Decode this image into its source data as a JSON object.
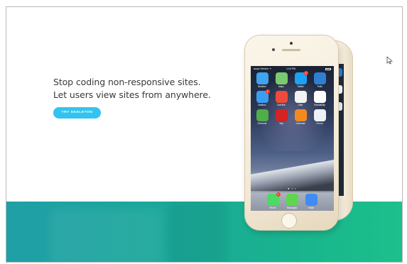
{
  "hero": {
    "headline_line1": "Stop coding non-responsive sites.",
    "headline_line2": "Let users view sites from anywhere.",
    "cta_label": "TRY SKELETON"
  },
  "colors": {
    "cta": "#33c3f0",
    "band_start": "#1f9fa6",
    "band_end": "#1cc08c",
    "phone_gold": "#f5ecda"
  },
  "phone": {
    "status_carrier": "●●●● Verizon ᯤ",
    "status_time": "1:16 PM",
    "page_dots": "● • •",
    "apps": [
      {
        "name": "Weather",
        "icon": "weather-icon",
        "color": "#3fa3ef"
      },
      {
        "name": "Maps",
        "icon": "maps-icon",
        "color": "#7bc96f"
      },
      {
        "name": "Twitter",
        "icon": "twitter-icon",
        "color": "#1da1f2",
        "badge": "1"
      },
      {
        "name": "Trello",
        "icon": "trello-icon",
        "color": "#2f7fd1"
      },
      {
        "name": "Mailbox",
        "icon": "mailbox-icon",
        "color": "#3a9ef0",
        "badge": "1"
      },
      {
        "name": "DotHide",
        "icon": "dot-icon",
        "color": "#ef4b3a"
      },
      {
        "name": "Ulfar",
        "icon": "ulfar-icon",
        "color": "#f2f2f2"
      },
      {
        "name": "Readability",
        "icon": "readability-icon",
        "color": "#ffffff"
      },
      {
        "name": "Evernote",
        "icon": "evernote-icon",
        "color": "#4fae45"
      },
      {
        "name": "Yelp",
        "icon": "yelp-icon",
        "color": "#d32323"
      },
      {
        "name": "Overcast",
        "icon": "overcast-icon",
        "color": "#f48a1e"
      },
      {
        "name": "Chrom",
        "icon": "chrome-icon",
        "color": "#eef2f7"
      }
    ],
    "dock": [
      {
        "name": "Phone",
        "icon": "phone-icon",
        "color": "#4cd964",
        "badge": "1"
      },
      {
        "name": "Messages",
        "icon": "messages-icon",
        "color": "#5fd64d"
      },
      {
        "name": "Safari",
        "icon": "safari-icon",
        "color": "#3f8cf2"
      }
    ]
  }
}
